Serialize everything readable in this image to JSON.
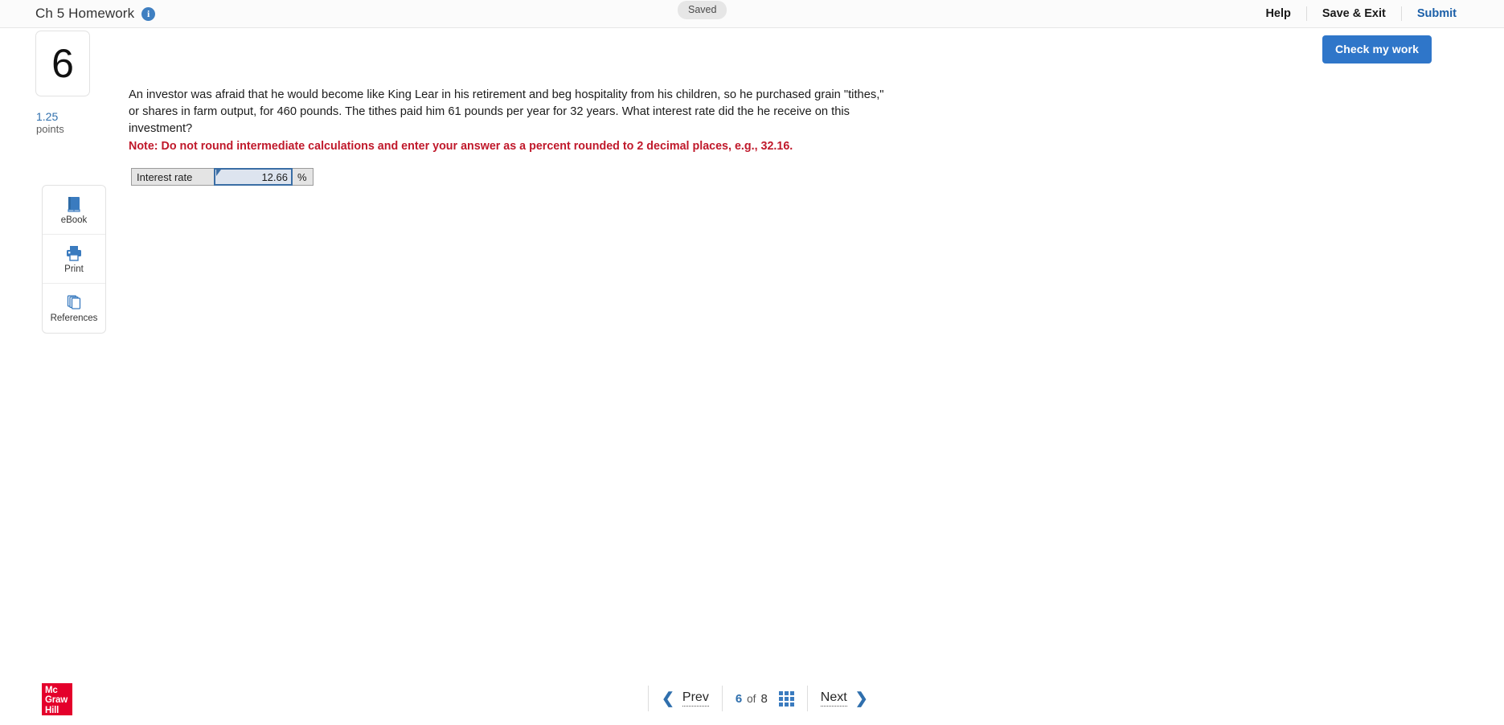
{
  "header": {
    "title": "Ch 5 Homework",
    "info_icon": "info-icon",
    "status_badge": "Saved",
    "actions": [
      {
        "label": "Help",
        "style": "dark"
      },
      {
        "label": "Save & Exit",
        "style": "dark"
      },
      {
        "label": "Submit",
        "style": "blue"
      }
    ]
  },
  "question": {
    "number": "6",
    "points_value": "1.25",
    "points_label": "points",
    "text": "An investor was afraid that he would become like King Lear in his retirement and beg hospitality from his children, so he purchased grain \"tithes,\" or shares in farm output, for 460 pounds. The tithes paid him 61 pounds per year for 32 years. What interest rate did the he receive on this investment?",
    "note": "Note: Do not round intermediate calculations and enter your answer as a percent rounded to 2 decimal places, e.g., 32.16."
  },
  "tools": [
    {
      "label": "eBook",
      "icon": "book-icon"
    },
    {
      "label": "Print",
      "icon": "printer-icon"
    },
    {
      "label": "References",
      "icon": "references-icon"
    }
  ],
  "main": {
    "check_button": "Check my work"
  },
  "answer": {
    "label": "Interest rate",
    "value": "12.66",
    "placeholder": "",
    "unit": "%"
  },
  "footer": {
    "logo_line1": "Mc",
    "logo_line2": "Graw",
    "logo_line3": "Hill",
    "prev_label": "Prev",
    "next_label": "Next",
    "current_page": "6",
    "of_label": "of",
    "total_pages": "8",
    "grid_icon": "grid-icon"
  },
  "colors": {
    "accent_blue": "#2f76c9",
    "link_blue": "#2f6fad",
    "note_red": "#c0192b",
    "logo_red": "#e4002b",
    "input_border": "#3a6ea5",
    "input_fill": "#dde4ef",
    "cell_gray": "#e4e4e4"
  }
}
